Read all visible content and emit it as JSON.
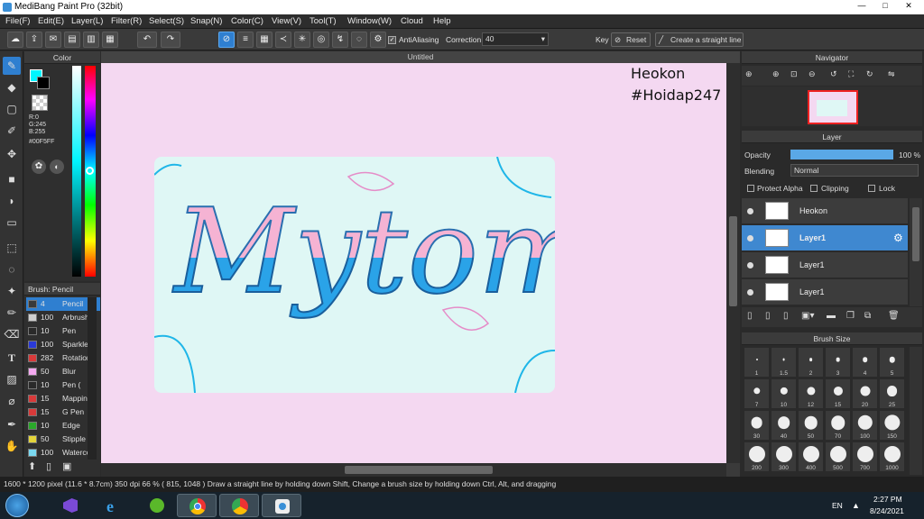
{
  "window": {
    "title": "MediBang Paint Pro (32bit)",
    "minimize": "—",
    "maximize": "□",
    "close": "✕"
  },
  "menu": [
    "File(F)",
    "Edit(E)",
    "Layer(L)",
    "Filter(R)",
    "Select(S)",
    "Snap(N)",
    "Color(C)",
    "View(V)",
    "Tool(T)",
    "Window(W)",
    "Cloud",
    "Help"
  ],
  "toolbar": {
    "antialiasing_label": "AntiAliasing",
    "antialiasing_checked": true,
    "correction_label": "Correction",
    "correction_value": "40",
    "key_label": "Key",
    "reset_label": "Reset",
    "straight_line_label": "Create a straight line"
  },
  "color_panel": {
    "title": "Color",
    "r": "R:0",
    "g": "G:245",
    "b": "B:255",
    "hex": "#00F5FF",
    "fg_color": "#00F5FF",
    "bg_color": "#000000"
  },
  "brush_panel": {
    "title": "Brush: Pencil",
    "items": [
      {
        "size": "4",
        "name": "Pencil",
        "color": "#3a3a3a",
        "selected": true
      },
      {
        "size": "100",
        "name": "Arbrush",
        "color": "#cfcfcf"
      },
      {
        "size": "10",
        "name": "Pen",
        "color": "#2a2a2a"
      },
      {
        "size": "100",
        "name": "Sparkle",
        "color": "#2a3ad8"
      },
      {
        "size": "282",
        "name": "Rotation",
        "color": "#d83a3a"
      },
      {
        "size": "50",
        "name": "Blur",
        "color": "#f3a8ef"
      },
      {
        "size": "10",
        "name": "Pen (",
        "color": "#2a2a2a"
      },
      {
        "size": "15",
        "name": "Mapping",
        "color": "#d83a3a"
      },
      {
        "size": "15",
        "name": "G Pen",
        "color": "#d83a3a"
      },
      {
        "size": "10",
        "name": "Edge",
        "color": "#2aa82a"
      },
      {
        "size": "50",
        "name": "Stipple",
        "color": "#e3d43a"
      },
      {
        "size": "100",
        "name": "Watercolor",
        "color": "#7ad8f0"
      }
    ]
  },
  "canvas": {
    "tab_title": "Untitled",
    "watermark_line1": "Heokon",
    "watermark_line2": "#Hoidap247",
    "art_text": "Mytomi"
  },
  "navigator": {
    "title": "Navigator"
  },
  "layer_panel": {
    "title": "Layer",
    "opacity_label": "Opacity",
    "opacity_value": "100 %",
    "opacity_fraction": 1.0,
    "blending_label": "Blending",
    "blending_value": "Normal",
    "protect_alpha_label": "Protect Alpha",
    "clipping_label": "Clipping",
    "lock_label": "Lock",
    "layers": [
      {
        "name": "Heokon",
        "selected": false
      },
      {
        "name": "Layer1",
        "selected": true
      },
      {
        "name": "Layer1",
        "selected": false
      },
      {
        "name": "Layer1",
        "selected": false
      }
    ]
  },
  "brush_size_panel": {
    "title": "Brush Size",
    "sizes": [
      "1",
      "1.5",
      "2",
      "3",
      "4",
      "5",
      "7",
      "10",
      "12",
      "15",
      "20",
      "25",
      "30",
      "40",
      "50",
      "70",
      "100",
      "150",
      "200",
      "300",
      "400",
      "500",
      "700",
      "1000"
    ]
  },
  "status": {
    "text": "1600 * 1200 pixel   (11.6 * 8.7cm)   350 dpi   66 %   ( 815, 1048 )   Draw a straight line by holding down Shift, Change a brush size by holding down Ctrl, Alt, and dragging"
  },
  "taskbar": {
    "language": "EN",
    "time": "2:27 PM",
    "date": "8/24/2021"
  },
  "colors": {
    "accent": "#2f7fd0",
    "canvas_bg": "#f4d8f1",
    "artboard": "#dff7f5",
    "pink": "#f5b3d3",
    "blue": "#2aa3e8"
  }
}
